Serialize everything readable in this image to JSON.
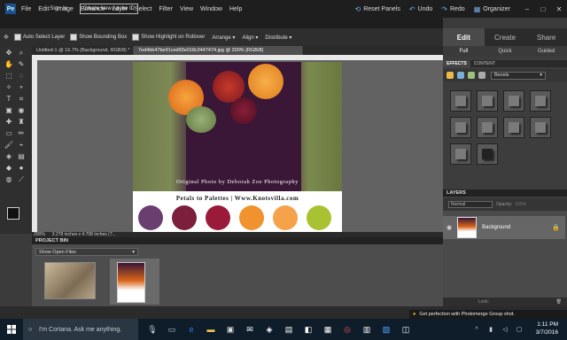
{
  "menubar": {
    "items": [
      "File",
      "Edit",
      "Image",
      "Enhance",
      "Layer",
      "Select",
      "Filter",
      "View",
      "Window",
      "Help"
    ],
    "signin": "Sign In",
    "create_adobe_id": "Create New Adobe ID",
    "reset_panels": "Reset Panels",
    "undo": "Undo",
    "redo": "Redo",
    "organizer": "Organizer"
  },
  "options": {
    "auto_select": "Auto Select Layer",
    "show_bounding": "Show Bounding Box",
    "show_highlight": "Show Highlight on Rollover",
    "arrange": "Arrange",
    "align": "Align",
    "distribute": "Distribute"
  },
  "mode_tabs": {
    "edit": "Edit",
    "create": "Create",
    "share": "Share"
  },
  "sub_tabs": {
    "full": "Full",
    "quick": "Quick",
    "guided": "Guided"
  },
  "doc_tabs": [
    {
      "label": "Untitled-1 @ 16.7% (Background, RGB/8) *"
    },
    {
      "label": "7ed4bb47be91ced93e018c3447474.jpg @ 200% (RGB/8)"
    }
  ],
  "photo": {
    "credit": "Original Photo by Deborah Zoe Photography",
    "title": "Petals to Palettes | Www.Knotsvilla.com"
  },
  "palette": [
    "#6a3e6e",
    "#7b1f3c",
    "#9a1a3a",
    "#f0922e",
    "#f5a24a",
    "#a9c232"
  ],
  "statusbar": {
    "zoom": "200%",
    "info": "3.278 inches x 4.708 inches (7..."
  },
  "project_bin": {
    "title": "PROJECT BIN",
    "select": "Show Open Files"
  },
  "effects": {
    "tab1": "EFFECTS",
    "tab2": "CONTENT",
    "select": "Bevels"
  },
  "layers": {
    "title": "LAYERS",
    "blend": "Normal",
    "opacity_label": "Opacity:",
    "opacity": "100%",
    "layer_name": "Background",
    "lock_label": "Lock:"
  },
  "tooltip": "Get perfection with Photomerge Group shot.",
  "taskbar": {
    "cortana": "I'm Cortana. Ask me anything.",
    "time": "1:11 PM",
    "date": "3/7/2016"
  },
  "colors": {
    "accent": "#1d4e8f",
    "panel": "#3d3d3d",
    "dark": "#1e1e1e"
  }
}
